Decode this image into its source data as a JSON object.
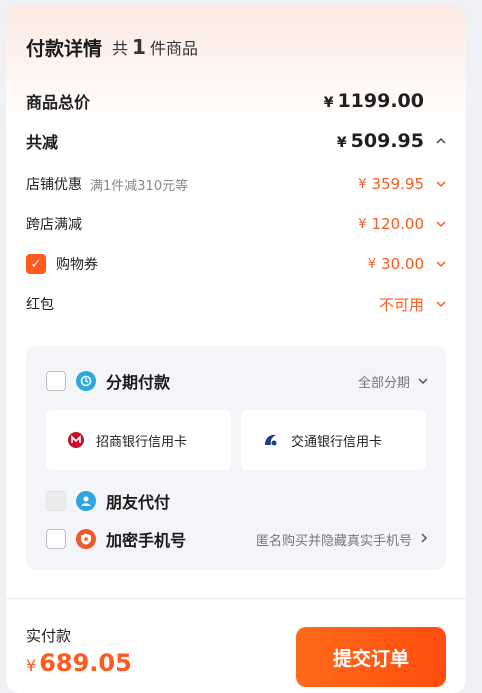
{
  "header": {
    "title": "付款详情",
    "count_prefix": "共",
    "count": "1",
    "count_suffix": "件商品"
  },
  "summary": {
    "total_label": "商品总价",
    "total_currency": "¥",
    "total_value": "1199.00",
    "discount_label": "共减",
    "discount_currency": "¥",
    "discount_value": "509.95",
    "discount_expanded": true
  },
  "discounts": [
    {
      "label": "店铺优惠",
      "note": "满1件减310元等",
      "currency": "¥",
      "value": "359.95"
    },
    {
      "label": "跨店满减",
      "note": "",
      "currency": "¥",
      "value": "120.00"
    },
    {
      "label": "购物券",
      "note": "",
      "currency": "¥",
      "value": "30.00",
      "checked": true
    },
    {
      "label": "红包",
      "note": "",
      "currency": "",
      "value": "不可用"
    }
  ],
  "payment_methods": {
    "installment": {
      "label": "分期付款",
      "right_label": "全部分期",
      "checked": false,
      "banks": [
        {
          "label": "招商银行信用卡",
          "icon": "cmb-bank-icon"
        },
        {
          "label": "交通银行信用卡",
          "icon": "bocom-bank-icon"
        }
      ]
    },
    "friend_pay": {
      "label": "朋友代付",
      "disabled": true
    },
    "encrypted_phone": {
      "label": "加密手机号",
      "right_label": "匿名购买并隐藏真实手机号",
      "checked": false
    }
  },
  "footer": {
    "pay_label": "实付款",
    "pay_currency": "¥",
    "pay_value": "689.05",
    "submit_label": "提交订单"
  },
  "colors": {
    "accent": "#ff5a1f",
    "panel_bg": "#f3f5f8"
  }
}
